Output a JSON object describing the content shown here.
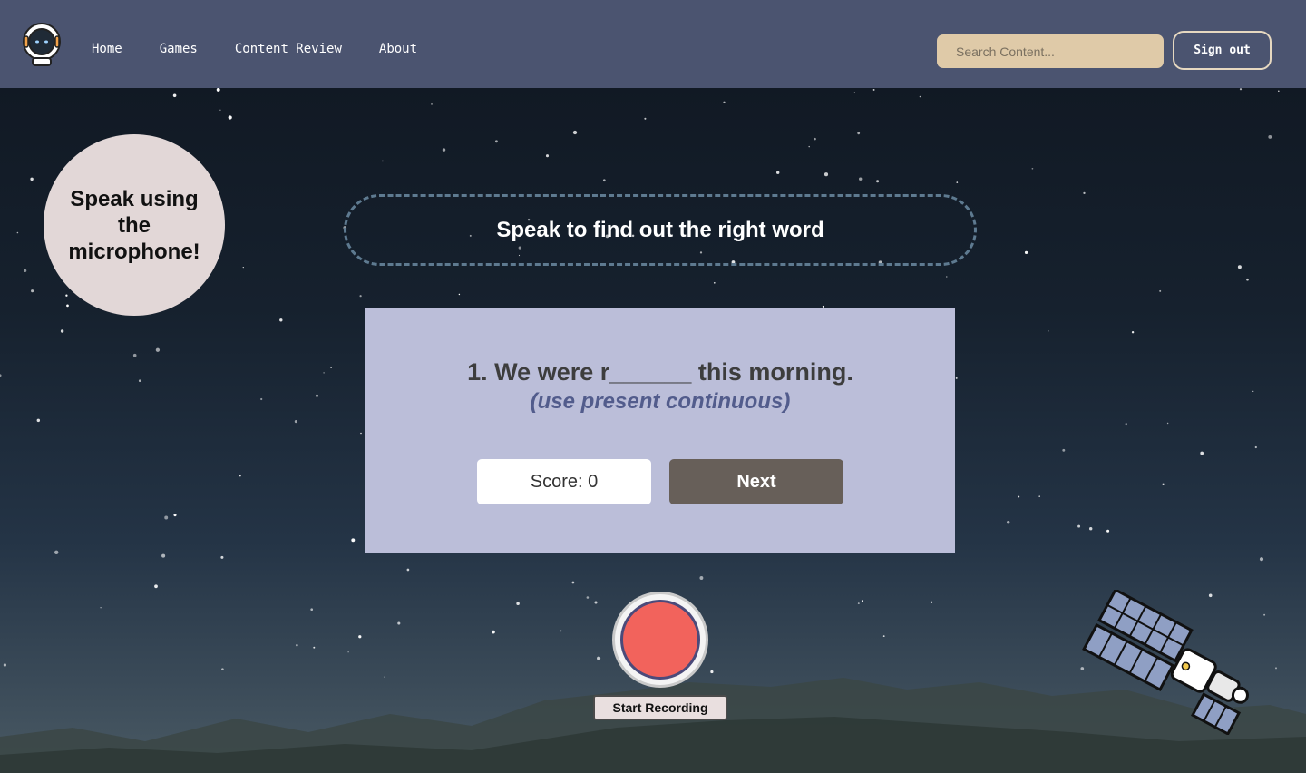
{
  "header": {
    "logo_icon": "astronaut-icon",
    "nav": [
      "Home",
      "Games",
      "Content Review",
      "About"
    ],
    "search_placeholder": "Search Content...",
    "signout_label": "Sign out"
  },
  "bubble": {
    "text": "Speak using the microphone!"
  },
  "banner": {
    "text": "Speak to find out the right word"
  },
  "question": {
    "text": "1. We were r______ this morning.",
    "hint": "(use present continuous)"
  },
  "score_label": "Score: 0",
  "next_label": "Next",
  "recording": {
    "label": "Start Recording",
    "button_color": "#f2635c"
  },
  "decor": {
    "satellite_icon": "satellite-icon"
  },
  "colors": {
    "header_bg": "#4b5470",
    "card_bg": "#bbbed9",
    "next_bg": "#675f59",
    "search_bg": "#dfcaa8",
    "bubble_bg": "#e2d7d7"
  }
}
